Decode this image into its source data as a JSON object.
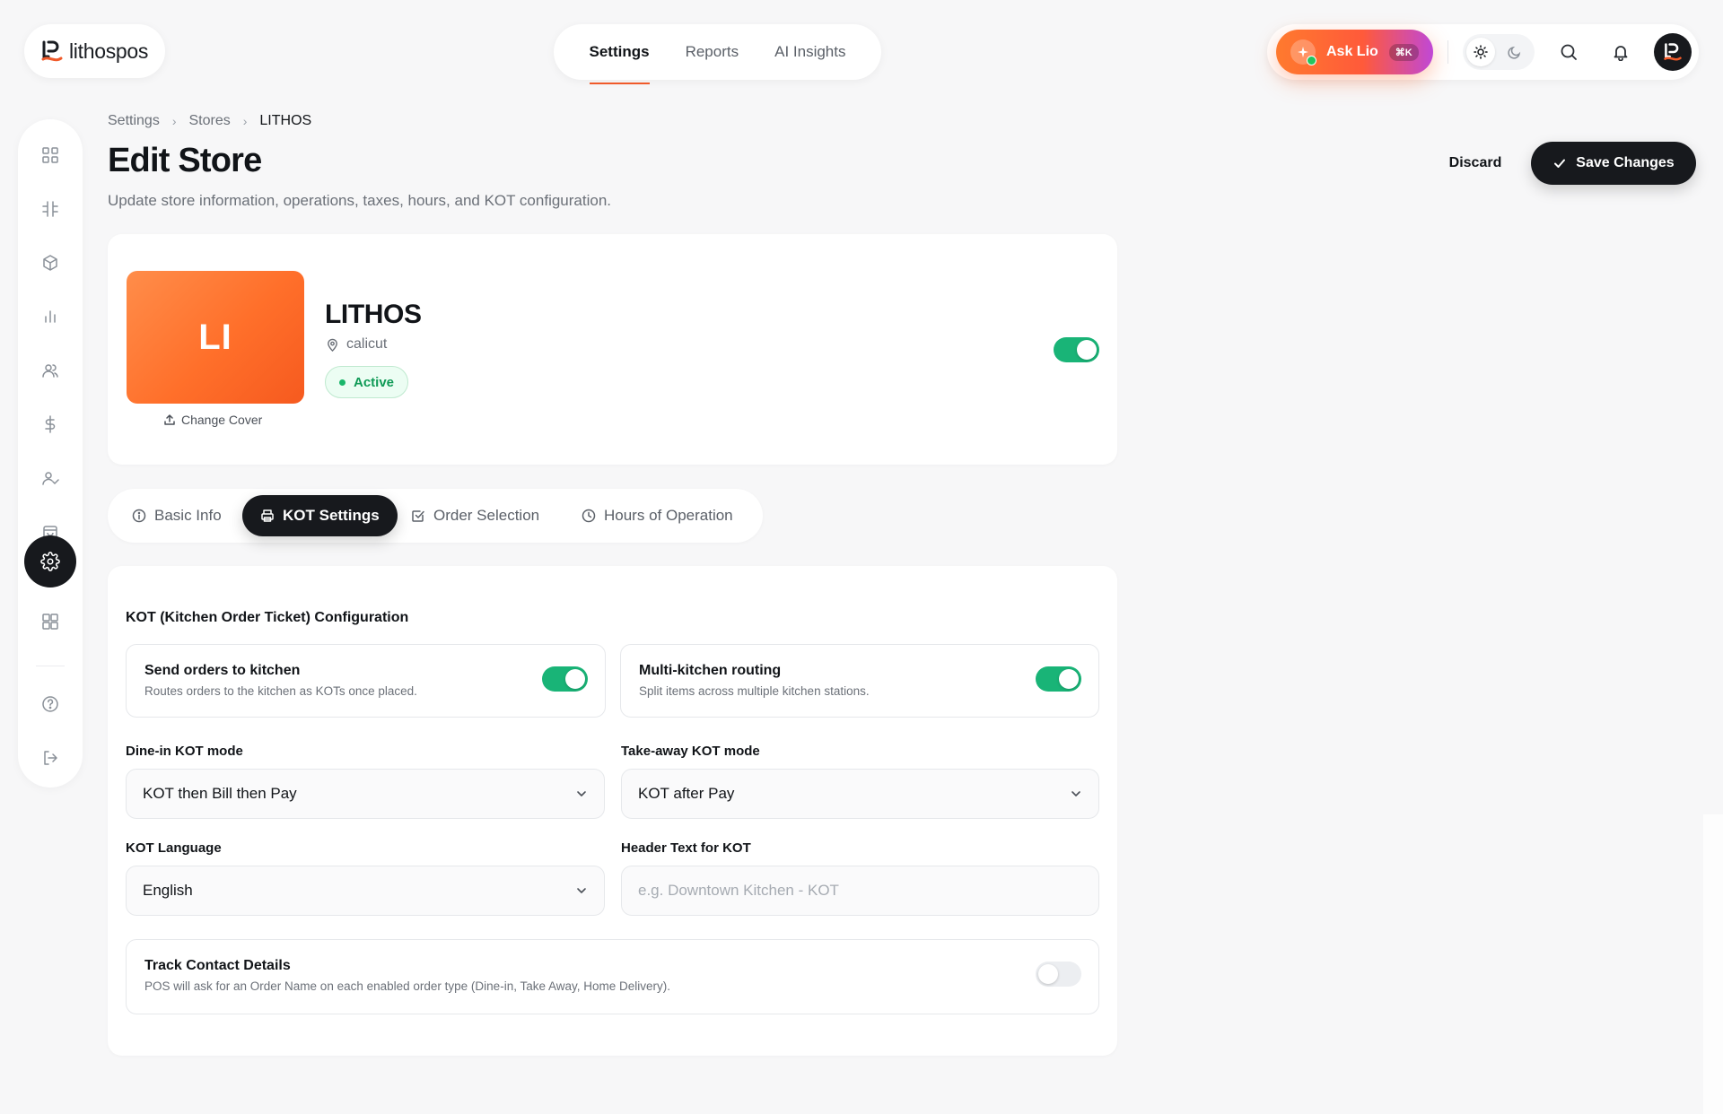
{
  "brand": {
    "name": "lithospos",
    "accent": "#f05a2a"
  },
  "top_nav": {
    "items": [
      "Settings",
      "Reports",
      "AI Insights"
    ],
    "active": "Settings"
  },
  "ask": {
    "label": "Ask Lio",
    "shortcut": "⌘K"
  },
  "breadcrumb": [
    "Settings",
    "Stores",
    "LITHOS"
  ],
  "header": {
    "title": "Edit Store",
    "subtitle": "Update store information, operations, taxes, hours, and KOT configuration.",
    "discard_label": "Discard",
    "save_label": "Save Changes"
  },
  "store": {
    "initials": "LI",
    "name": "LITHOS",
    "location": "calicut",
    "status": "Active",
    "change_cover_label": "Change Cover",
    "enabled": true
  },
  "tabs": [
    {
      "label": "Basic Info",
      "icon": "info-icon"
    },
    {
      "label": "KOT Settings",
      "icon": "printer-icon",
      "active": true
    },
    {
      "label": "Order Selection",
      "icon": "checkbox-icon"
    },
    {
      "label": "Hours of Operation",
      "icon": "clock-icon"
    }
  ],
  "kot": {
    "section_title": "KOT (Kitchen Order Ticket) Configuration",
    "send_orders": {
      "title": "Send orders to kitchen",
      "desc": "Routes orders to the kitchen as KOTs once placed.",
      "enabled": true
    },
    "multi_kitchen": {
      "title": "Multi-kitchen routing",
      "desc": "Split items across multiple kitchen stations.",
      "enabled": true
    },
    "dine_in": {
      "label": "Dine-in KOT mode",
      "value": "KOT then Bill then Pay"
    },
    "take_away": {
      "label": "Take-away KOT mode",
      "value": "KOT after Pay"
    },
    "language": {
      "label": "KOT Language",
      "value": "English"
    },
    "header_text": {
      "label": "Header Text for KOT",
      "value": "",
      "placeholder": "e.g. Downtown Kitchen - KOT"
    },
    "track_contact": {
      "title": "Track Contact Details",
      "desc": "POS will ask for an Order Name on each enabled order type (Dine-in, Take Away, Home Delivery).",
      "enabled": false
    }
  },
  "colors": {
    "primary_dark": "#17191d",
    "success": "#19b477",
    "cover_orange": "#ff6f2a"
  }
}
